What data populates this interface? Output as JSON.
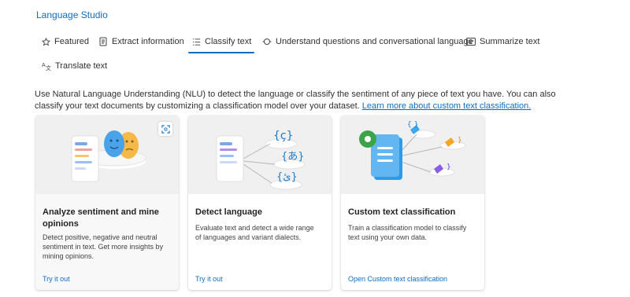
{
  "app": {
    "title": "Language Studio"
  },
  "tabs": [
    {
      "label": "Featured",
      "icon": "star-icon",
      "active": false
    },
    {
      "label": "Extract information",
      "icon": "document-icon",
      "active": false
    },
    {
      "label": "Classify text",
      "icon": "list-icon",
      "active": true
    },
    {
      "label": "Understand questions and conversational language",
      "icon": "conversation-icon",
      "active": false
    },
    {
      "label": "Summarize text",
      "icon": "summary-icon",
      "active": false
    },
    {
      "label": "Translate text",
      "icon": "translate-icon",
      "active": false
    }
  ],
  "description": {
    "text": "Use Natural Language Understanding (NLU) to detect the language or classify the sentiment of any piece of text you have. You can also classify your text documents by customizing a classification model over your dataset. ",
    "link": "Learn more about custom text classification."
  },
  "cards": [
    {
      "title": "Analyze sentiment and mine opinions",
      "description": "Detect positive, negative and neutral sentiment in text. Get more insights by mining opinions.",
      "link": "Try it out",
      "illustration": "sentiment-faces"
    },
    {
      "title": "Detect language",
      "description": "Evaluate text and detect a wide range of languages and variant dialects.",
      "link": "Try it out",
      "illustration": "language-bubbles"
    },
    {
      "title": "Custom text classification",
      "description": "Train a classification model to classify text using your own data.",
      "link": "Open Custom text classification",
      "illustration": "classification-tree"
    }
  ],
  "colors": {
    "accent": "#0f6cbd",
    "cardArt": "#f0f0f0"
  }
}
